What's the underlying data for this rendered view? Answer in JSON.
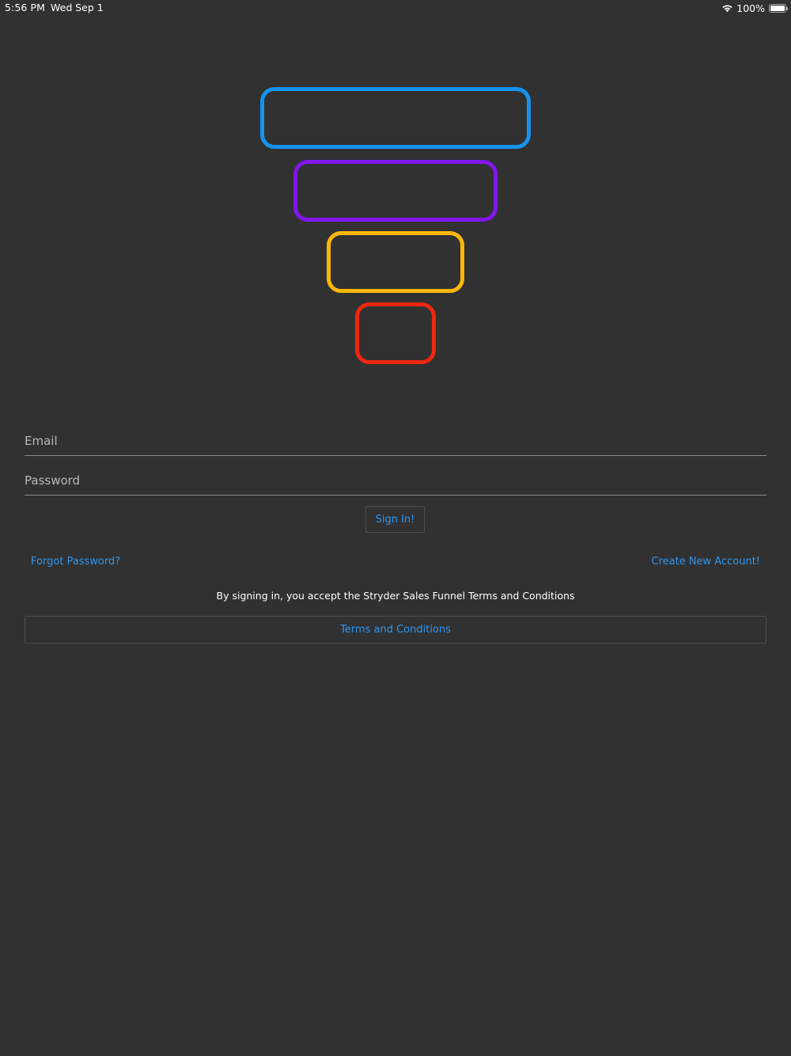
{
  "status_bar": {
    "time": "5:56 PM",
    "date": "Wed Sep 1",
    "battery_percent": "100%",
    "battery_level": 1.0,
    "icons": [
      "wifi-icon",
      "battery-icon"
    ]
  },
  "logo": {
    "icon": "funnel-logo",
    "tier_colors": [
      "#1593ee",
      "#8016ec",
      "#fdb705",
      "#ee2711"
    ]
  },
  "form": {
    "email_placeholder": "Email",
    "email_value": "",
    "password_placeholder": "Password",
    "password_value": "",
    "sign_in_label": "Sign In!"
  },
  "links": {
    "forgot_password": "Forgot Password?",
    "create_account": "Create New Account!"
  },
  "terms": {
    "note": "By signing in, you accept the Stryder Sales Funnel Terms and Conditions",
    "button_label": "Terms and Conditions"
  },
  "colors": {
    "background": "#313131",
    "accent": "#2f96ee",
    "text": "#ffffff"
  }
}
